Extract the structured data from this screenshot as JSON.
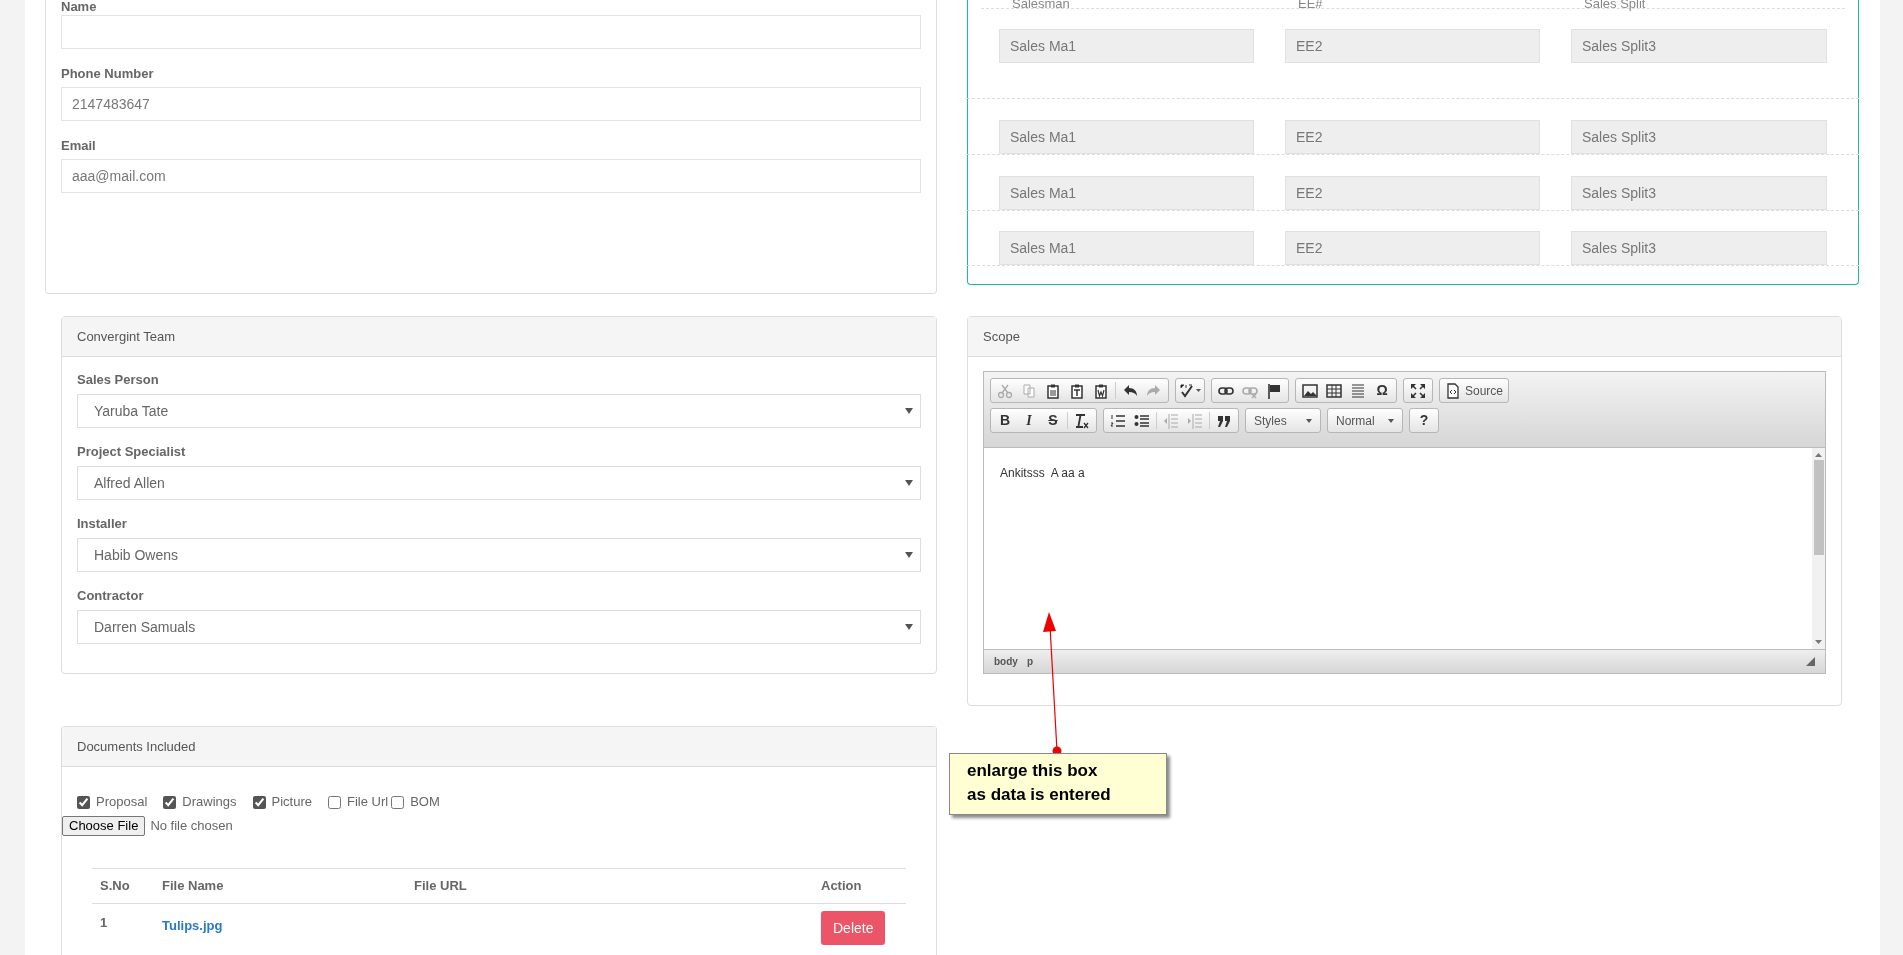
{
  "contact": {
    "fields": [
      {
        "label": "Name"
      },
      {
        "label": "Phone Number",
        "value": "2147483647"
      },
      {
        "label": "Email",
        "value": "aaa@mail.com"
      }
    ]
  },
  "sales_split": {
    "columns": [
      "Salesman",
      "EE#",
      "Sales Split"
    ],
    "rows": [
      [
        "Sales Ma1",
        "EE2",
        "Sales Split3"
      ],
      [
        "Sales Ma1",
        "EE2",
        "Sales Split3"
      ],
      [
        "Sales Ma1",
        "EE2",
        "Sales Split3"
      ],
      [
        "Sales Ma1",
        "EE2",
        "Sales Split3"
      ]
    ]
  },
  "team": {
    "title": "Convergint Team",
    "fields": [
      {
        "label": "Sales Person",
        "value": "Yaruba Tate"
      },
      {
        "label": "Project Specialist",
        "value": "Alfred Allen"
      },
      {
        "label": "Installer",
        "value": "Habib Owens"
      },
      {
        "label": "Contractor",
        "value": "Darren Samuals"
      }
    ]
  },
  "scope": {
    "title": "Scope",
    "toolbar": [
      [
        [
          {
            "kind": "cut",
            "disabled": true
          },
          {
            "kind": "copy",
            "disabled": true
          },
          {
            "kind": "paste",
            "disabled": false
          },
          {
            "kind": "pastetext",
            "disabled": false
          },
          {
            "kind": "pasteword",
            "disabled": false
          },
          {
            "kind": "separator"
          },
          {
            "kind": "undo",
            "disabled": false
          },
          {
            "kind": "redo",
            "disabled": true
          }
        ],
        [
          {
            "kind": "spellcheck",
            "disabled": false
          }
        ],
        [
          {
            "kind": "link",
            "disabled": false
          },
          {
            "kind": "unlink",
            "disabled": true
          },
          {
            "kind": "anchor",
            "disabled": false
          }
        ],
        [
          {
            "kind": "image",
            "disabled": false
          },
          {
            "kind": "table",
            "disabled": false
          },
          {
            "kind": "hline",
            "disabled": false
          },
          {
            "kind": "glyph",
            "text": "Ω",
            "disabled": false
          }
        ],
        [
          {
            "kind": "maximize",
            "disabled": false
          }
        ],
        [
          {
            "kind": "source",
            "text": "Source",
            "disabled": false
          }
        ]
      ],
      [
        [
          {
            "kind": "bold",
            "text": "B",
            "disabled": false
          },
          {
            "kind": "italic",
            "text": "I",
            "disabled": false
          },
          {
            "kind": "strike",
            "text": "S",
            "disabled": false
          },
          {
            "kind": "separator"
          },
          {
            "kind": "removeformat",
            "disabled": false
          }
        ],
        [
          {
            "kind": "numlist",
            "disabled": false
          },
          {
            "kind": "bulletlist",
            "disabled": false
          },
          {
            "kind": "separator"
          },
          {
            "kind": "outdent",
            "disabled": true
          },
          {
            "kind": "indent",
            "disabled": true
          },
          {
            "kind": "separator"
          },
          {
            "kind": "blockquote",
            "disabled": false
          }
        ],
        [
          {
            "kind": "combo",
            "text": "Styles",
            "disabled": false
          }
        ],
        [
          {
            "kind": "combo",
            "text": "Normal",
            "disabled": false
          }
        ],
        [
          {
            "kind": "glyph",
            "text": "?",
            "disabled": false
          }
        ]
      ]
    ],
    "content": "Ankitsss  A aa a",
    "path": [
      "body",
      "p"
    ]
  },
  "documents": {
    "title": "Documents Included",
    "options": [
      {
        "label": "Proposal",
        "checked": true
      },
      {
        "label": "Drawings",
        "checked": true
      },
      {
        "label": "Picture",
        "checked": true
      },
      {
        "label": "File Url",
        "checked": false
      },
      {
        "label": "BOM",
        "checked": false
      }
    ],
    "file_button": "Choose File",
    "file_status": "No file chosen",
    "table": {
      "columns": [
        "S.No",
        "File Name",
        "File URL",
        "Action"
      ],
      "rows": [
        {
          "sno": "1",
          "file_name": "Tulips.jpg",
          "action": "Delete"
        }
      ]
    }
  },
  "annotation": {
    "text": "enlarge this box\nas data is entered"
  }
}
